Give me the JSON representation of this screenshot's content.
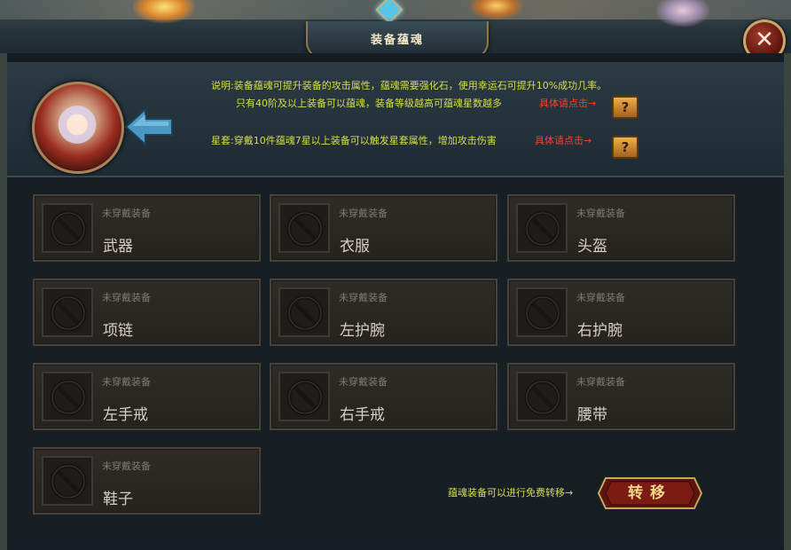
{
  "window": {
    "title": "装备蕴魂",
    "close_label": "✕"
  },
  "info": {
    "line1": "说明:装备蕴魂可提升装备的攻击属性，蕴魂需要强化石，使用幸运石可提升10%成功几率。",
    "line2": "只有40阶及以上装备可以蕴魂，装备等级越高可蕴魂星数越多",
    "line2_link": "具体请点击→",
    "line3": "星套:穿戴10件蕴魂7星以上装备可以触发星套属性，增加攻击伤害",
    "line3_link": "具体请点击→",
    "help_label": "?"
  },
  "slots": [
    {
      "status": "未穿戴装备",
      "name": "武器"
    },
    {
      "status": "未穿戴装备",
      "name": "衣服"
    },
    {
      "status": "未穿戴装备",
      "name": "头盔"
    },
    {
      "status": "未穿戴装备",
      "name": "项链"
    },
    {
      "status": "未穿戴装备",
      "name": "左护腕"
    },
    {
      "status": "未穿戴装备",
      "name": "右护腕"
    },
    {
      "status": "未穿戴装备",
      "name": "左手戒"
    },
    {
      "status": "未穿戴装备",
      "name": "右手戒"
    },
    {
      "status": "未穿戴装备",
      "name": "腰带"
    },
    {
      "status": "未穿戴装备",
      "name": "鞋子"
    }
  ],
  "transfer": {
    "hint": "蕴魂装备可以进行免费转移→",
    "button_label": "转移"
  },
  "icons": {
    "empty_slot": "no-entry-icon",
    "back": "arrow-left-icon",
    "close": "close-icon",
    "help": "question-icon"
  }
}
